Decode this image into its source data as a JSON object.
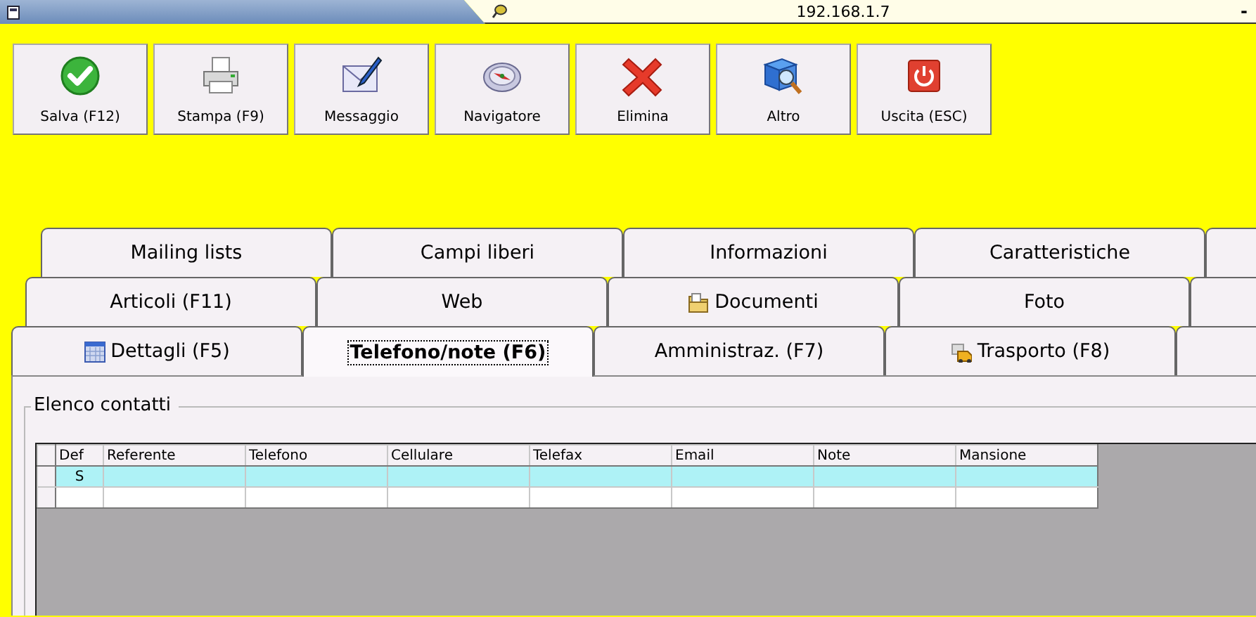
{
  "window": {
    "title": "192.168.1.7",
    "minimize": "-"
  },
  "toolbar": [
    {
      "label": "Salva (F12)",
      "kind": "check"
    },
    {
      "label": "Stampa (F9)",
      "kind": "printer"
    },
    {
      "label": "Messaggio",
      "kind": "mail"
    },
    {
      "label": "Navigatore",
      "kind": "compass"
    },
    {
      "label": "Elimina",
      "kind": "cross"
    },
    {
      "label": "Altro",
      "kind": "book"
    },
    {
      "label": "Uscita (ESC)",
      "kind": "power"
    }
  ],
  "tab_rows": [
    [
      {
        "label": "Mailing lists",
        "selected": false
      },
      {
        "label": "Campi liberi",
        "selected": false
      },
      {
        "label": "Informazioni",
        "selected": false
      },
      {
        "label": "Caratteristiche",
        "selected": false
      }
    ],
    [
      {
        "label": "Articoli (F11)",
        "selected": false
      },
      {
        "label": "Web",
        "selected": false
      },
      {
        "label": "Documenti",
        "kind": "folder",
        "selected": false
      },
      {
        "label": "Foto",
        "selected": false
      }
    ],
    [
      {
        "label": "Dettagli (F5)",
        "kind": "calendar",
        "selected": false
      },
      {
        "label": "Telefono/note (F6)",
        "selected": true
      },
      {
        "label": "Amministraz. (F7)",
        "selected": false
      },
      {
        "label": "Trasporto (F8)",
        "kind": "truck",
        "selected": false
      }
    ]
  ],
  "group": {
    "title": "Elenco contatti"
  },
  "table": {
    "columns": [
      "Def",
      "Referente",
      "Telefono",
      "Cellulare",
      "Telefax",
      "Email",
      "Note",
      "Mansione"
    ],
    "rows": [
      {
        "selected": true,
        "def": "S"
      },
      {
        "selected": false
      }
    ]
  }
}
